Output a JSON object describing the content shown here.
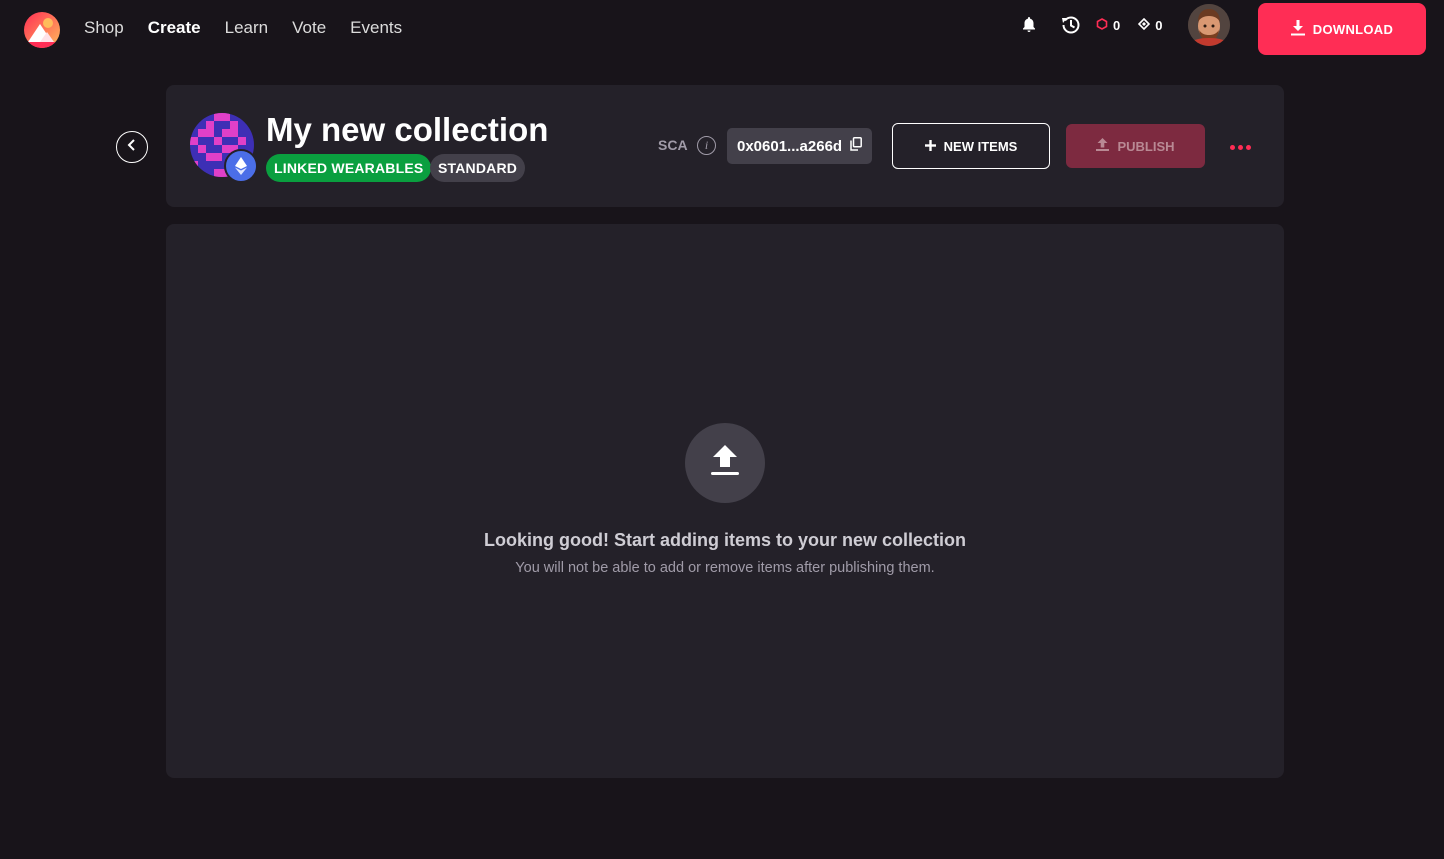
{
  "nav": {
    "items": [
      {
        "label": "Shop",
        "active": false
      },
      {
        "label": "Create",
        "active": true
      },
      {
        "label": "Learn",
        "active": false
      },
      {
        "label": "Vote",
        "active": false
      },
      {
        "label": "Events",
        "active": false
      }
    ]
  },
  "toolbar": {
    "mana_polygon_count": "0",
    "mana_ethereum_count": "0",
    "download_label": "DOWNLOAD"
  },
  "collection": {
    "title": "My new collection",
    "tags": [
      "LINKED WEARABLES",
      "STANDARD"
    ],
    "sca_label": "SCA",
    "address": "0x0601...a266d",
    "new_items_label": "NEW ITEMS",
    "publish_label": "PUBLISH"
  },
  "empty_state": {
    "title": "Looking good! Start adding items to your new collection",
    "subtitle": "You will not be able to add or remove items after publishing them."
  },
  "colors": {
    "accent": "#ff2d55",
    "linked_tag": "#0a9f3f",
    "card_bg": "#242129",
    "page_bg": "#18141a"
  },
  "icons": [
    "decentraland-logo-icon",
    "bell-icon",
    "history-icon",
    "polygon-mana-icon",
    "ethereum-mana-icon",
    "download-icon",
    "chevron-left-icon",
    "ethereum-icon",
    "info-icon",
    "copy-icon",
    "plus-icon",
    "upload-icon",
    "more-dots-icon"
  ]
}
